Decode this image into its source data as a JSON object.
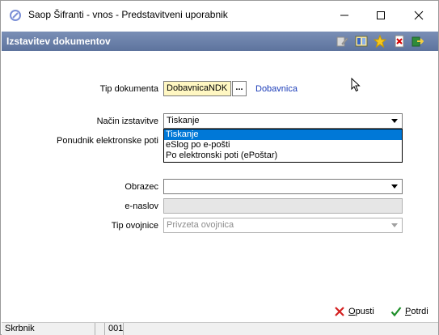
{
  "window": {
    "title": "Saop Šifranti - vnos - Predstavitveni uporabnik"
  },
  "header": {
    "title": "Izstavitev dokumentov"
  },
  "form": {
    "tip_dokumenta": {
      "label": "Tip dokumenta",
      "value": "DobavnicaNDK",
      "button": "...",
      "description": "Dobavnica"
    },
    "nacin_izstavitve": {
      "label": "Način izstavitve",
      "value": "Tiskanje",
      "options": [
        "Tiskanje",
        "eSlog po e-pošti",
        "Po elektronski poti (ePoštar)"
      ]
    },
    "ponudnik": {
      "label": "Ponudnik elektronske poti"
    },
    "obrazec": {
      "label": "Obrazec",
      "value": ""
    },
    "e_naslov": {
      "label": "e-naslov",
      "value": ""
    },
    "tip_ovojnice": {
      "label": "Tip ovojnice",
      "value": "Privzeta ovojnica"
    }
  },
  "footer": {
    "cancel": {
      "underlined": "O",
      "rest": "pusti"
    },
    "confirm": {
      "underlined": "P",
      "rest": "otrdi"
    }
  },
  "status": {
    "user": "Skrbnik",
    "code": "001"
  },
  "colors": {
    "header_band": "#5d739d",
    "link": "#1a3bb8",
    "highlight": "#0078d7",
    "tip_field_bg": "#fff7c2"
  }
}
